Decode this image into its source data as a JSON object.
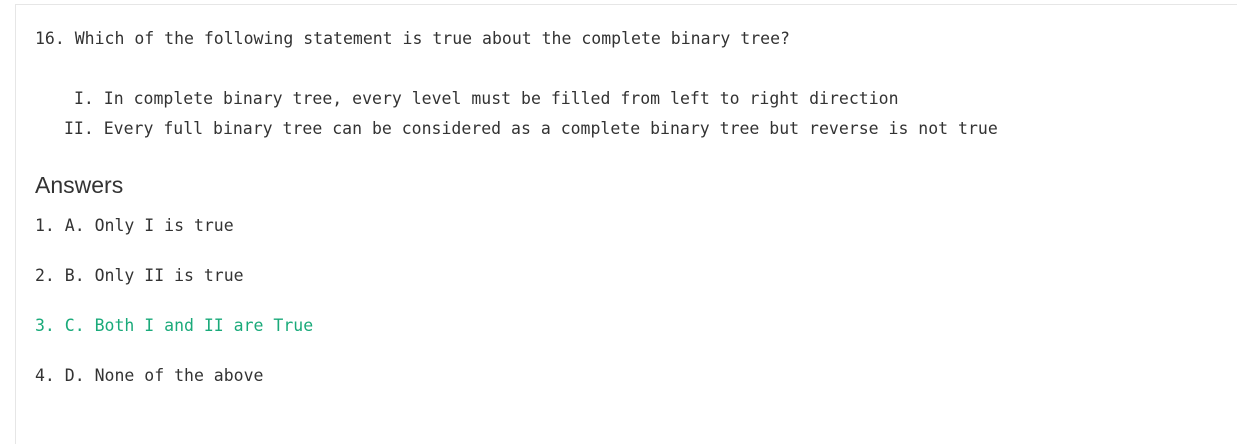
{
  "question": {
    "text": "16. Which of the following statement is true about the complete binary tree?"
  },
  "statements": [
    {
      "text": "I. In complete binary tree, every level must be filled from left to right direction"
    },
    {
      "text": "II. Every full binary tree can be considered as a complete binary tree but reverse is not true"
    }
  ],
  "answers": {
    "heading": "Answers",
    "items": [
      {
        "text": "1. A. Only I is true"
      },
      {
        "text": "2. B. Only II is true"
      },
      {
        "text": "3. C. Both I and II are True"
      },
      {
        "text": "4. D. None of the above"
      }
    ],
    "correct_color": "#1aaa7a"
  }
}
